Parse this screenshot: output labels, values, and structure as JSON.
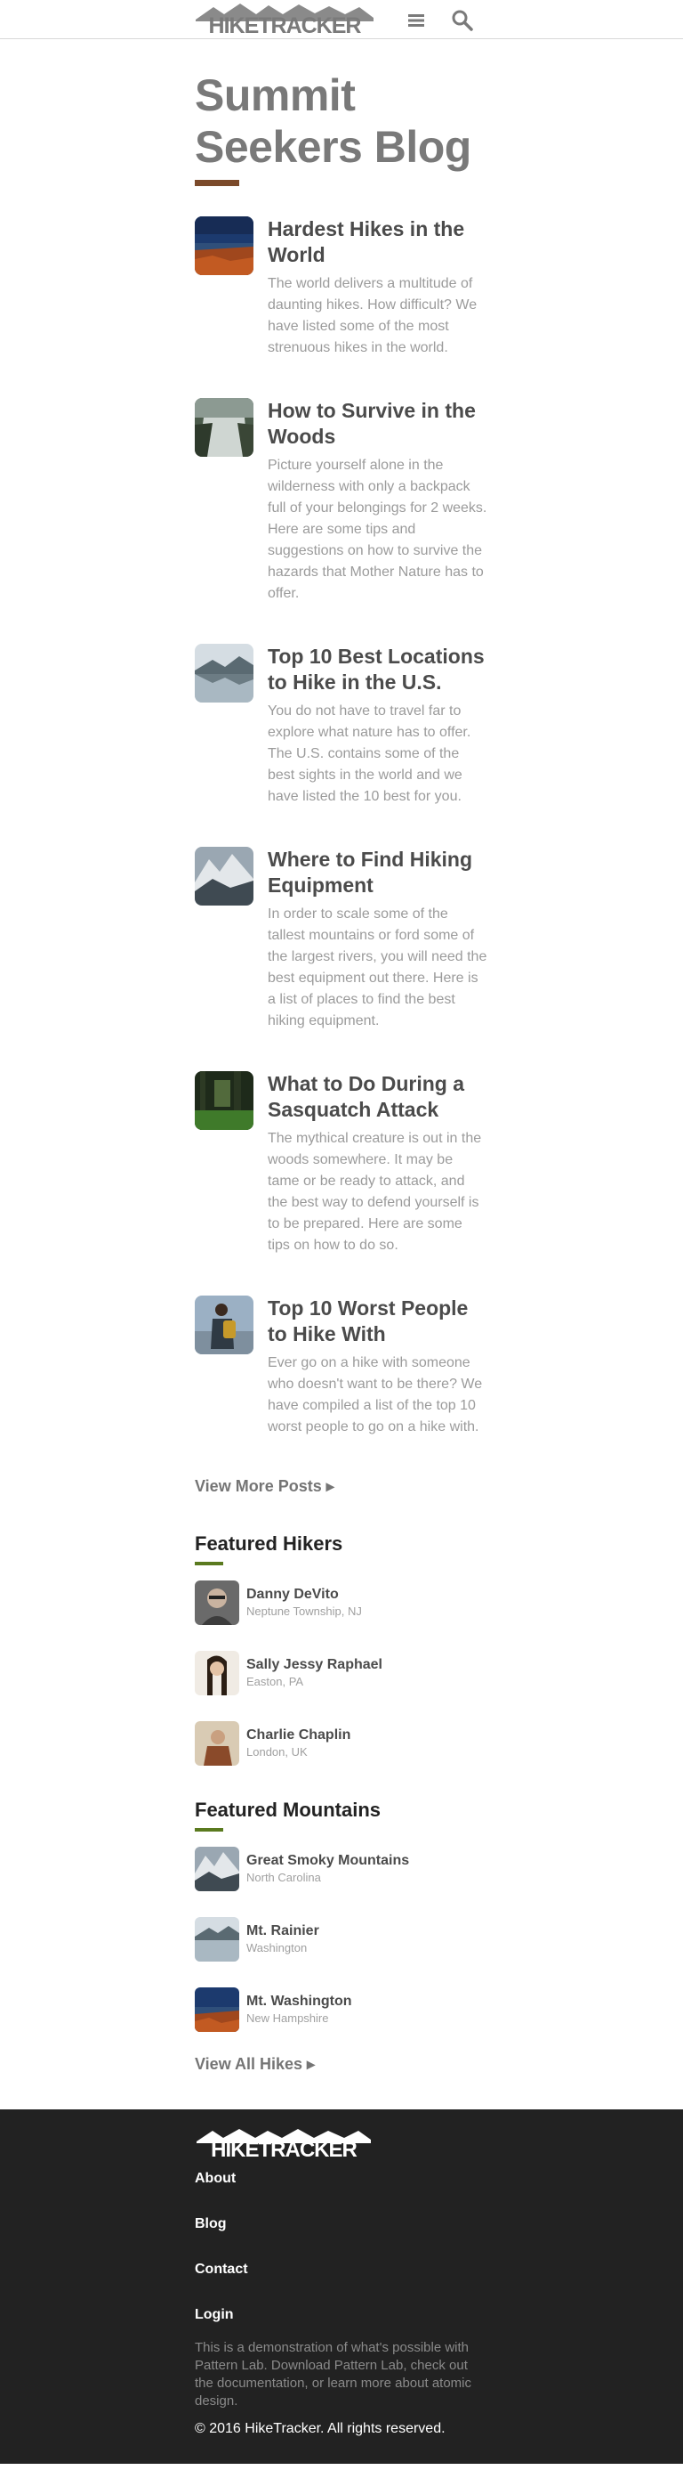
{
  "header": {
    "logo_text": "HIKETRACKER"
  },
  "page": {
    "title": "Summit Seekers Blog"
  },
  "posts": [
    {
      "title": "Hardest Hikes in the World",
      "excerpt": "The world delivers a multitude of daunting hikes. How difficult? We have listed some of the most strenuous hikes in the world.",
      "thumb": "red-forest-lake"
    },
    {
      "title": "How to Survive in the Woods",
      "excerpt": "Picture yourself alone in the wilderness with only a backpack full of your belongings for 2 weeks. Here are some tips and suggestions on how to survive the hazards that Mother Nature has to offer.",
      "thumb": "waterfall"
    },
    {
      "title": "Top 10 Best Locations to Hike in the U.S.",
      "excerpt": "You do not have to travel far to explore what nature has to offer. The U.S. contains some of the best sights in the world and we have listed the 10 best for you.",
      "thumb": "mountain-lake"
    },
    {
      "title": "Where to Find Hiking Equipment",
      "excerpt": "In order to scale some of the tallest mountains or ford some of the largest rivers, you will need the best equipment out there. Here is a list of places to find the best hiking equipment.",
      "thumb": "snowy-mountains"
    },
    {
      "title": "What to Do During a Sasquatch Attack",
      "excerpt": "The mythical creature is out in the woods somewhere. It may be tame or be ready to attack, and the best way to defend yourself is to be prepared. Here are some tips on how to do so.",
      "thumb": "dark-forest"
    },
    {
      "title": "Top 10 Worst People to Hike With",
      "excerpt": "Ever go on a hike with someone who doesn't want to be there? We have compiled a list of the top 10 worst people to go on a hike with.",
      "thumb": "hiker-backpack"
    }
  ],
  "view_more_posts": "View More Posts ▸",
  "featured_hikers": {
    "title": "Featured Hikers",
    "items": [
      {
        "name": "Danny DeVito",
        "location": "Neptune Township, NJ",
        "thumb": "portrait-man"
      },
      {
        "name": "Sally Jessy Raphael",
        "location": "Easton, PA",
        "thumb": "portrait-woman"
      },
      {
        "name": "Charlie Chaplin",
        "location": "London, UK",
        "thumb": "portrait-coat"
      }
    ]
  },
  "featured_mountains": {
    "title": "Featured Mountains",
    "items": [
      {
        "name": "Great Smoky Mountains",
        "location": "North Carolina",
        "thumb": "snowy-mountains"
      },
      {
        "name": "Mt. Rainier",
        "location": "Washington",
        "thumb": "mountain-lake"
      },
      {
        "name": "Mt. Washington",
        "location": "New Hampshire",
        "thumb": "red-forest-lake"
      }
    ]
  },
  "view_all_hikes": "View All Hikes ▸",
  "footer": {
    "logo_text": "HIKETRACKER",
    "links": [
      "About",
      "Blog",
      "Contact",
      "Login"
    ],
    "description": "This is a demonstration of what's possible with Pattern Lab. Download Pattern Lab, check out the documentation, or learn more about atomic design.",
    "copyright": "© 2016 HikeTracker. All rights reserved."
  },
  "colors": {
    "title_rule": "#7b4a2a",
    "section_rule": "#5a7a1f",
    "footer_bg": "#222222"
  },
  "icons": [
    "menu-icon",
    "search-icon"
  ]
}
